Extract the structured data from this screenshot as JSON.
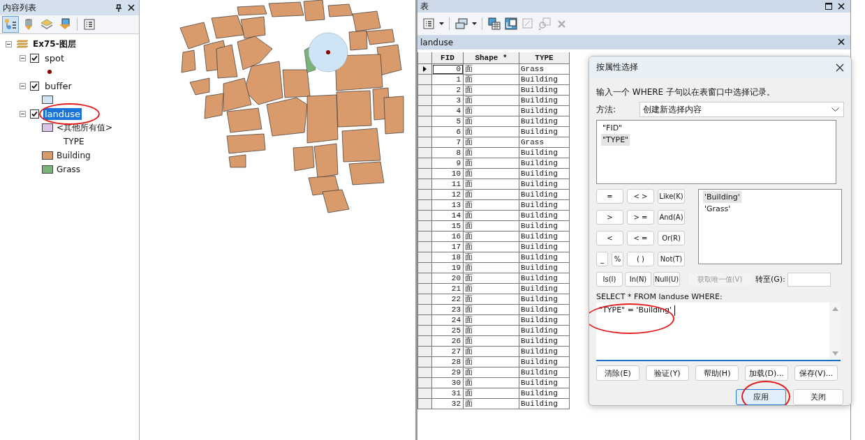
{
  "toc": {
    "title": "内容列表",
    "tools": [
      {
        "kind": "drawing-order",
        "selected": true
      },
      {
        "kind": "source",
        "selected": false
      },
      {
        "kind": "visibility",
        "selected": false
      },
      {
        "kind": "selection",
        "selected": false
      },
      {
        "kind": "options",
        "selected": false
      }
    ],
    "map": {
      "title": "Ex75-图层",
      "expanded": true
    },
    "layers": [
      {
        "name": "spot",
        "checked": true,
        "expanded": true,
        "selected": false,
        "circled": false,
        "legend": [
          {
            "kind": "point",
            "color": "#8b0000"
          }
        ]
      },
      {
        "name": "buffer",
        "checked": true,
        "expanded": true,
        "selected": false,
        "circled": false,
        "legend": [
          {
            "kind": "fill",
            "color": "#cfe4f5"
          }
        ]
      },
      {
        "name": "landuse",
        "checked": true,
        "expanded": true,
        "selected": true,
        "circled": true,
        "legend": [
          {
            "kind": "fill",
            "label": "<其他所有值>",
            "color": "#dcc4ea"
          },
          {
            "kind": "heading",
            "label": "TYPE"
          },
          {
            "kind": "fill",
            "label": "Building",
            "color": "#d99a6c"
          },
          {
            "kind": "fill",
            "label": "Grass",
            "color": "#7ab37a"
          }
        ]
      }
    ]
  },
  "table_window": {
    "title": "表",
    "tools": [
      {
        "kind": "table-options",
        "dropdown": true,
        "disabled": false
      },
      {
        "kind": "related-tables",
        "dropdown": true,
        "disabled": false
      },
      {
        "kind": "select-by-attributes",
        "dropdown": false,
        "disabled": false
      },
      {
        "kind": "switch-selection",
        "dropdown": false,
        "disabled": false
      },
      {
        "kind": "clear-selection",
        "dropdown": false,
        "disabled": true
      },
      {
        "kind": "zoom-selected",
        "dropdown": false,
        "disabled": true
      },
      {
        "kind": "delete",
        "dropdown": false,
        "disabled": true
      }
    ],
    "tab": "landuse",
    "columns": [
      "FID",
      "Shape *",
      "TYPE"
    ],
    "rows": [
      {
        "cells": [
          "0",
          "面",
          "Grass"
        ],
        "current": true
      },
      {
        "cells": [
          "1",
          "面",
          "Building"
        ],
        "current": false
      },
      {
        "cells": [
          "2",
          "面",
          "Building"
        ],
        "current": false
      },
      {
        "cells": [
          "3",
          "面",
          "Building"
        ],
        "current": false
      },
      {
        "cells": [
          "4",
          "面",
          "Building"
        ],
        "current": false
      },
      {
        "cells": [
          "5",
          "面",
          "Building"
        ],
        "current": false
      },
      {
        "cells": [
          "6",
          "面",
          "Building"
        ],
        "current": false
      },
      {
        "cells": [
          "7",
          "面",
          "Grass"
        ],
        "current": false
      },
      {
        "cells": [
          "8",
          "面",
          "Building"
        ],
        "current": false
      },
      {
        "cells": [
          "9",
          "面",
          "Building"
        ],
        "current": false
      },
      {
        "cells": [
          "10",
          "面",
          "Building"
        ],
        "current": false
      },
      {
        "cells": [
          "11",
          "面",
          "Building"
        ],
        "current": false
      },
      {
        "cells": [
          "12",
          "面",
          "Building"
        ],
        "current": false
      },
      {
        "cells": [
          "13",
          "面",
          "Building"
        ],
        "current": false
      },
      {
        "cells": [
          "14",
          "面",
          "Building"
        ],
        "current": false
      },
      {
        "cells": [
          "15",
          "面",
          "Building"
        ],
        "current": false
      },
      {
        "cells": [
          "16",
          "面",
          "Building"
        ],
        "current": false
      },
      {
        "cells": [
          "17",
          "面",
          "Building"
        ],
        "current": false
      },
      {
        "cells": [
          "18",
          "面",
          "Building"
        ],
        "current": false
      },
      {
        "cells": [
          "19",
          "面",
          "Building"
        ],
        "current": false
      },
      {
        "cells": [
          "20",
          "面",
          "Building"
        ],
        "current": false
      },
      {
        "cells": [
          "21",
          "面",
          "Building"
        ],
        "current": false
      },
      {
        "cells": [
          "22",
          "面",
          "Building"
        ],
        "current": false
      },
      {
        "cells": [
          "23",
          "面",
          "Building"
        ],
        "current": false
      },
      {
        "cells": [
          "24",
          "面",
          "Building"
        ],
        "current": false
      },
      {
        "cells": [
          "25",
          "面",
          "Building"
        ],
        "current": false
      },
      {
        "cells": [
          "26",
          "面",
          "Building"
        ],
        "current": false
      },
      {
        "cells": [
          "27",
          "面",
          "Building"
        ],
        "current": false
      },
      {
        "cells": [
          "28",
          "面",
          "Building"
        ],
        "current": false
      },
      {
        "cells": [
          "29",
          "面",
          "Building"
        ],
        "current": false
      },
      {
        "cells": [
          "30",
          "面",
          "Building"
        ],
        "current": false
      },
      {
        "cells": [
          "31",
          "面",
          "Building"
        ],
        "current": false
      },
      {
        "cells": [
          "32",
          "面",
          "Building"
        ],
        "current": false
      }
    ]
  },
  "dialog": {
    "title": "按属性选择",
    "instruction": "输入一个 WHERE 子句以在表窗口中选择记录。",
    "method_label": "方法:",
    "method": "创建新选择内容",
    "fields": [
      {
        "label": "\"FID\"",
        "selected": false
      },
      {
        "label": "\"TYPE\"",
        "selected": true
      }
    ],
    "operators": [
      [
        "=",
        "< >",
        "Like(K)"
      ],
      [
        ">",
        "> =",
        "And(A)"
      ],
      [
        "<",
        "< =",
        "Or(R)"
      ],
      [
        "_",
        "%",
        "( )",
        "Not(T)"
      ]
    ],
    "values": [
      {
        "label": "'Building'",
        "selected": true
      },
      {
        "label": "'Grass'",
        "selected": false
      }
    ],
    "extra_buttons": [
      {
        "label": "Is(I)",
        "disabled": false
      },
      {
        "label": "In(N)",
        "disabled": false
      },
      {
        "label": "Null(U)",
        "disabled": false
      },
      {
        "label": "获取唯一值(V)",
        "disabled": true
      }
    ],
    "goto_label": "转至(G):",
    "query_label": "SELECT * FROM landuse WHERE:",
    "query": "\"TYPE\" = 'Building'",
    "query_circled": true,
    "buttons": [
      "清除(E)",
      "验证(Y)",
      "帮助(H)",
      "加载(D)...",
      "保存(V)..."
    ],
    "footer_buttons": [
      {
        "label": "应用",
        "default": true,
        "circled": true
      },
      {
        "label": "关闭",
        "default": false,
        "circled": false
      }
    ]
  }
}
